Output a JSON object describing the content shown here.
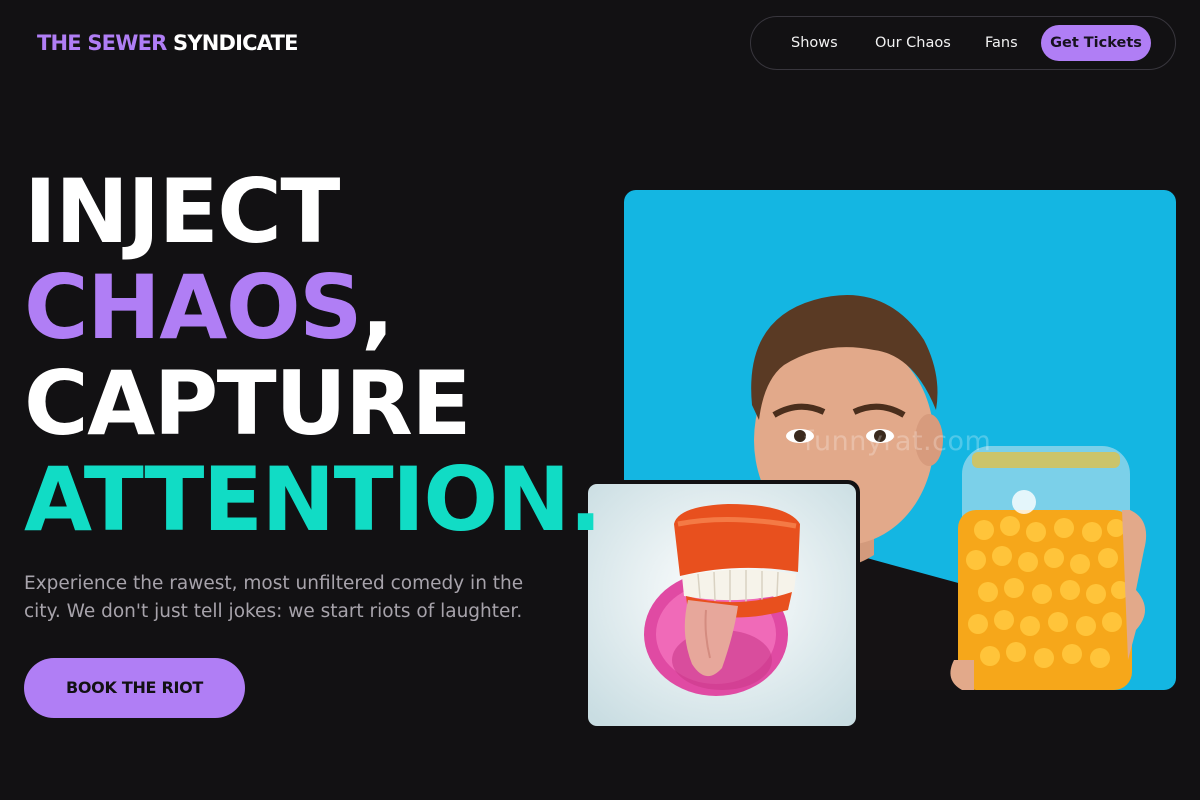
{
  "brand": {
    "name_part1": "THE SEWER",
    "name_part2": "SYNDICATE",
    "accent_color": "#b07ef5",
    "teal_color": "#11dcc5"
  },
  "nav": {
    "links": [
      "Shows",
      "Our Chaos",
      "Fans"
    ],
    "cta": "Get Tickets"
  },
  "hero": {
    "headline": {
      "line1": "INJECT",
      "line2": "CHAOS",
      "line2_punct": ",",
      "line3": "CAPTURE",
      "line4": "ATTENTION",
      "line4_punct": "."
    },
    "subtitle": "Experience the rawest, most unfiltered comedy in the city. We don't just tell jokes: we start riots of laughter.",
    "cta": "BOOK THE RIOT"
  },
  "images": {
    "main": {
      "subject": "man-with-cheese-puff-jar",
      "watermark": "funnyrat.com"
    },
    "secondary": {
      "subject": "wind-up-teeth-with-tongue"
    }
  }
}
